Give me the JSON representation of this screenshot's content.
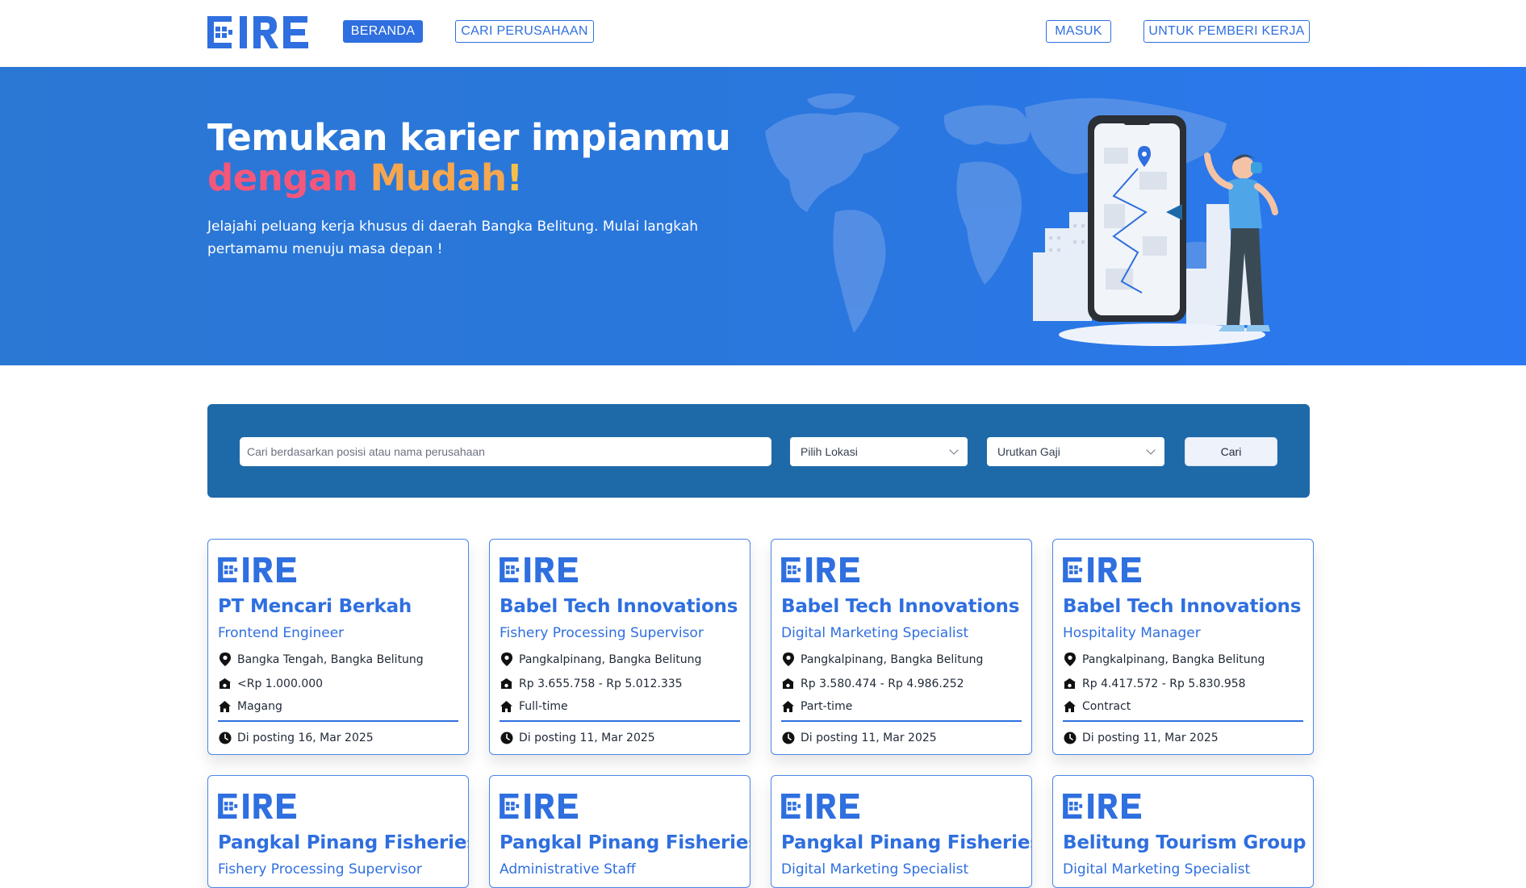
{
  "brand": {
    "name": "E:IRE",
    "color": "#2f6fdf"
  },
  "nav": {
    "home": "BERANDA",
    "search_company": "CARI PERUSAHAAN",
    "login": "MASUK",
    "employer": "UNTUK PEMBERI KERJA"
  },
  "hero": {
    "title_line1": "Temukan karier impianmu",
    "title_word1": "dengan",
    "title_word2": "Mudah",
    "title_word3": "!",
    "subtitle": "Jelajahi peluang kerja khusus di daerah Bangka Belitung. Mulai langkah pertamamu menuju masa depan !"
  },
  "search": {
    "placeholder": "Cari berdasarkan posisi atau nama perusahaan",
    "location_label": "Pilih Lokasi",
    "salary_label": "Urutkan Gaji",
    "button": "Cari"
  },
  "jobs": [
    {
      "company": "PT Mencari Berkah",
      "role": "Frontend Engineer",
      "location": "Bangka Tengah, Bangka Belitung",
      "salary": "<Rp 1.000.000",
      "type": "Magang",
      "posted": "Di posting 16, Mar 2025"
    },
    {
      "company": "Babel Tech Innovations",
      "role": "Fishery Processing Supervisor",
      "location": "Pangkalpinang, Bangka Belitung",
      "salary": "Rp 3.655.758 - Rp 5.012.335",
      "type": "Full-time",
      "posted": "Di posting 11, Mar 2025"
    },
    {
      "company": "Babel Tech Innovations",
      "role": "Digital Marketing Specialist",
      "location": "Pangkalpinang, Bangka Belitung",
      "salary": "Rp 3.580.474 - Rp 4.986.252",
      "type": "Part-time",
      "posted": "Di posting 11, Mar 2025"
    },
    {
      "company": "Babel Tech Innovations",
      "role": "Hospitality Manager",
      "location": "Pangkalpinang, Bangka Belitung",
      "salary": "Rp 4.417.572 - Rp 5.830.958",
      "type": "Contract",
      "posted": "Di posting 11, Mar 2025"
    },
    {
      "company": "Pangkal Pinang Fisheries",
      "role": "Fishery Processing Supervisor"
    },
    {
      "company": "Pangkal Pinang Fisheries",
      "role": "Administrative Staff"
    },
    {
      "company": "Pangkal Pinang Fisheries",
      "role": "Digital Marketing Specialist"
    },
    {
      "company": "Belitung Tourism Group",
      "role": "Digital Marketing Specialist"
    }
  ]
}
